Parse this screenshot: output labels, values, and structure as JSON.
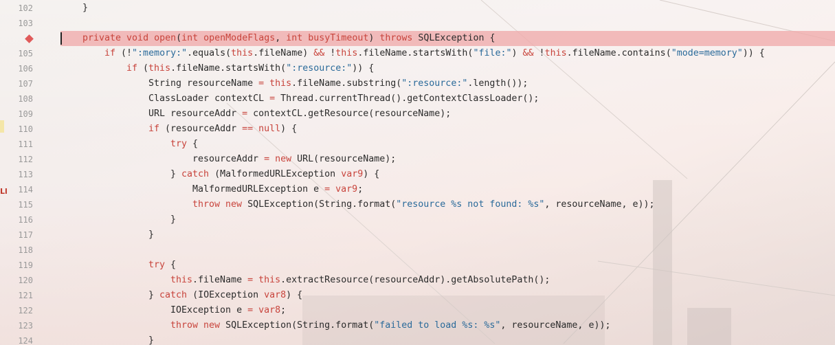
{
  "editor": {
    "colors": {
      "keyword": "#c8443c",
      "string": "#2a6a9a",
      "text": "#2b2b2b",
      "line_number": "#9a9a9a",
      "highlight": "#f0aaaa",
      "breakpoint": "#e05a5a"
    },
    "left_marker": "Ll",
    "breakpoint_line": "104",
    "lines": [
      {
        "num": "102",
        "indent": 1,
        "tokens": [
          {
            "t": "txt",
            "v": "}"
          }
        ]
      },
      {
        "num": "103",
        "indent": 0,
        "tokens": []
      },
      {
        "num": "",
        "indent": 1,
        "highlight": true,
        "tokens": [
          {
            "t": "kw",
            "v": "private "
          },
          {
            "t": "kw",
            "v": "void "
          },
          {
            "t": "fn",
            "v": "open"
          },
          {
            "t": "txt",
            "v": "("
          },
          {
            "t": "kw",
            "v": "int "
          },
          {
            "t": "var",
            "v": "openModeFlags"
          },
          {
            "t": "txt",
            "v": ", "
          },
          {
            "t": "kw",
            "v": "int "
          },
          {
            "t": "var",
            "v": "busyTimeout"
          },
          {
            "t": "txt",
            "v": ") "
          },
          {
            "t": "kw",
            "v": "throws "
          },
          {
            "t": "txt",
            "v": "SQLException {"
          }
        ]
      },
      {
        "num": "105",
        "indent": 2,
        "tokens": [
          {
            "t": "kw",
            "v": "if "
          },
          {
            "t": "txt",
            "v": "(!"
          },
          {
            "t": "str",
            "v": "\":memory:\""
          },
          {
            "t": "txt",
            "v": ".equals("
          },
          {
            "t": "this",
            "v": "this"
          },
          {
            "t": "txt",
            "v": ".fileName) "
          },
          {
            "t": "kw",
            "v": "&& "
          },
          {
            "t": "txt",
            "v": "!"
          },
          {
            "t": "this",
            "v": "this"
          },
          {
            "t": "txt",
            "v": ".fileName.startsWith("
          },
          {
            "t": "str",
            "v": "\"file:\""
          },
          {
            "t": "txt",
            "v": ") "
          },
          {
            "t": "kw",
            "v": "&& "
          },
          {
            "t": "txt",
            "v": "!"
          },
          {
            "t": "this",
            "v": "this"
          },
          {
            "t": "txt",
            "v": ".fileName.contains("
          },
          {
            "t": "str",
            "v": "\"mode=memory\""
          },
          {
            "t": "txt",
            "v": ")) {"
          }
        ]
      },
      {
        "num": "106",
        "indent": 3,
        "tokens": [
          {
            "t": "kw",
            "v": "if "
          },
          {
            "t": "txt",
            "v": "("
          },
          {
            "t": "this",
            "v": "this"
          },
          {
            "t": "txt",
            "v": ".fileName.startsWith("
          },
          {
            "t": "str",
            "v": "\":resource:\""
          },
          {
            "t": "txt",
            "v": ")) {"
          }
        ]
      },
      {
        "num": "107",
        "indent": 4,
        "tokens": [
          {
            "t": "txt",
            "v": "String resourceName "
          },
          {
            "t": "kw",
            "v": "= "
          },
          {
            "t": "this",
            "v": "this"
          },
          {
            "t": "txt",
            "v": ".fileName.substring("
          },
          {
            "t": "str",
            "v": "\":resource:\""
          },
          {
            "t": "txt",
            "v": ".length());"
          }
        ]
      },
      {
        "num": "108",
        "indent": 4,
        "tokens": [
          {
            "t": "txt",
            "v": "ClassLoader contextCL "
          },
          {
            "t": "kw",
            "v": "= "
          },
          {
            "t": "txt",
            "v": "Thread.currentThread().getContextClassLoader();"
          }
        ]
      },
      {
        "num": "109",
        "indent": 4,
        "tokens": [
          {
            "t": "txt",
            "v": "URL resourceAddr "
          },
          {
            "t": "kw",
            "v": "= "
          },
          {
            "t": "txt",
            "v": "contextCL.getResource(resourceName);"
          }
        ]
      },
      {
        "num": "110",
        "indent": 4,
        "tokens": [
          {
            "t": "kw",
            "v": "if "
          },
          {
            "t": "txt",
            "v": "(resourceAddr "
          },
          {
            "t": "kw",
            "v": "== "
          },
          {
            "t": "kw",
            "v": "null"
          },
          {
            "t": "txt",
            "v": ") {"
          }
        ]
      },
      {
        "num": "111",
        "indent": 5,
        "tokens": [
          {
            "t": "kw",
            "v": "try "
          },
          {
            "t": "txt",
            "v": "{"
          }
        ]
      },
      {
        "num": "112",
        "indent": 6,
        "tokens": [
          {
            "t": "txt",
            "v": "resourceAddr "
          },
          {
            "t": "kw",
            "v": "= "
          },
          {
            "t": "kw",
            "v": "new "
          },
          {
            "t": "txt",
            "v": "URL(resourceName);"
          }
        ]
      },
      {
        "num": "113",
        "indent": 5,
        "tokens": [
          {
            "t": "txt",
            "v": "} "
          },
          {
            "t": "kw",
            "v": "catch "
          },
          {
            "t": "txt",
            "v": "(MalformedURLException "
          },
          {
            "t": "var",
            "v": "var9"
          },
          {
            "t": "txt",
            "v": ") {"
          }
        ]
      },
      {
        "num": "114",
        "indent": 6,
        "tokens": [
          {
            "t": "txt",
            "v": "MalformedURLException e "
          },
          {
            "t": "kw",
            "v": "= "
          },
          {
            "t": "var",
            "v": "var9"
          },
          {
            "t": "txt",
            "v": ";"
          }
        ]
      },
      {
        "num": "115",
        "indent": 6,
        "tokens": [
          {
            "t": "kw",
            "v": "throw "
          },
          {
            "t": "kw",
            "v": "new "
          },
          {
            "t": "txt",
            "v": "SQLException(String.format("
          },
          {
            "t": "str",
            "v": "\"resource %s not found: %s\""
          },
          {
            "t": "txt",
            "v": ", resourceName, e));"
          }
        ]
      },
      {
        "num": "116",
        "indent": 5,
        "tokens": [
          {
            "t": "txt",
            "v": "}"
          }
        ]
      },
      {
        "num": "117",
        "indent": 4,
        "tokens": [
          {
            "t": "txt",
            "v": "}"
          }
        ]
      },
      {
        "num": "118",
        "indent": 0,
        "tokens": []
      },
      {
        "num": "119",
        "indent": 4,
        "tokens": [
          {
            "t": "kw",
            "v": "try "
          },
          {
            "t": "txt",
            "v": "{"
          }
        ]
      },
      {
        "num": "120",
        "indent": 5,
        "tokens": [
          {
            "t": "this",
            "v": "this"
          },
          {
            "t": "txt",
            "v": ".fileName "
          },
          {
            "t": "kw",
            "v": "= "
          },
          {
            "t": "this",
            "v": "this"
          },
          {
            "t": "txt",
            "v": ".extractResource(resourceAddr).getAbsolutePath();"
          }
        ]
      },
      {
        "num": "121",
        "indent": 4,
        "tokens": [
          {
            "t": "txt",
            "v": "} "
          },
          {
            "t": "kw",
            "v": "catch "
          },
          {
            "t": "txt",
            "v": "(IOException "
          },
          {
            "t": "var",
            "v": "var8"
          },
          {
            "t": "txt",
            "v": ") {"
          }
        ]
      },
      {
        "num": "122",
        "indent": 5,
        "tokens": [
          {
            "t": "txt",
            "v": "IOException e "
          },
          {
            "t": "kw",
            "v": "= "
          },
          {
            "t": "var",
            "v": "var8"
          },
          {
            "t": "txt",
            "v": ";"
          }
        ]
      },
      {
        "num": "123",
        "indent": 5,
        "tokens": [
          {
            "t": "kw",
            "v": "throw "
          },
          {
            "t": "kw",
            "v": "new "
          },
          {
            "t": "txt",
            "v": "SQLException(String.format("
          },
          {
            "t": "str",
            "v": "\"failed to load %s: %s\""
          },
          {
            "t": "txt",
            "v": ", resourceName, e));"
          }
        ]
      },
      {
        "num": "124",
        "indent": 4,
        "tokens": [
          {
            "t": "txt",
            "v": "}"
          }
        ]
      }
    ]
  }
}
